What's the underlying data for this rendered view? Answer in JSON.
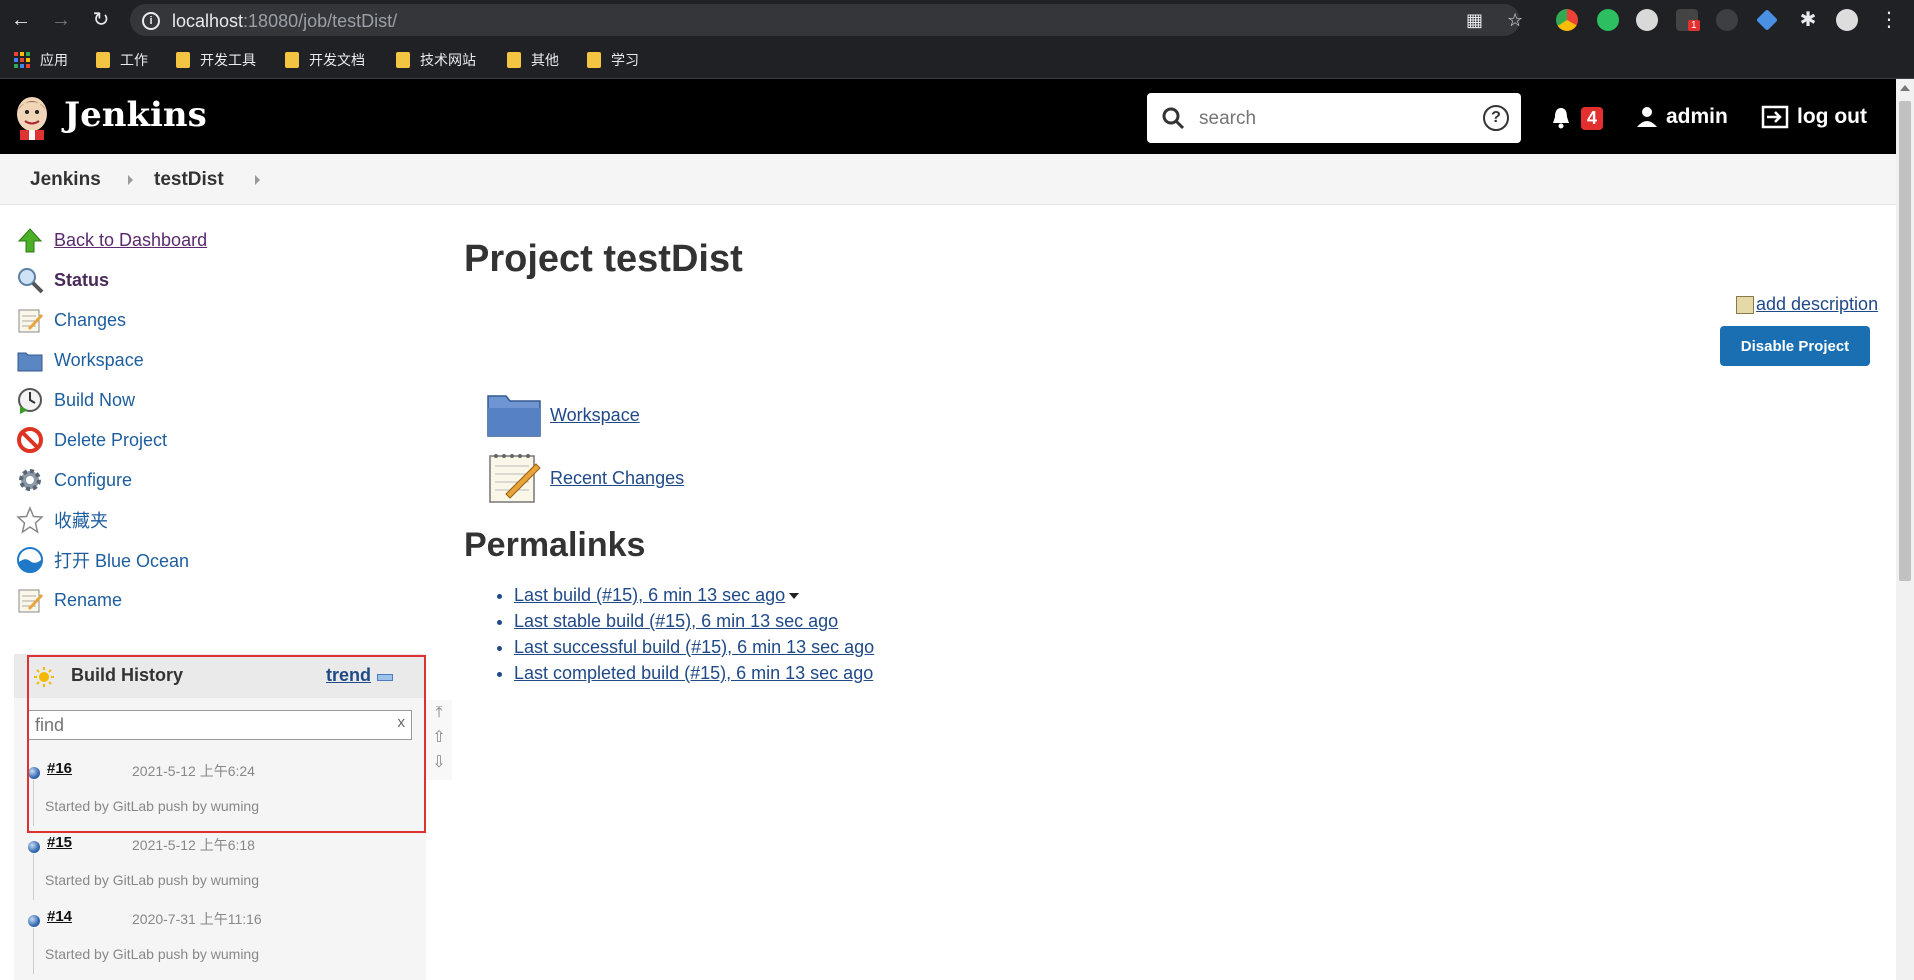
{
  "browser": {
    "url_host": "localhost",
    "url_path": ":18080/job/testDist/",
    "bookmarks": [
      {
        "label": "应用",
        "type": "apps"
      },
      {
        "label": "工作",
        "type": "folder"
      },
      {
        "label": "开发工具",
        "type": "folder"
      },
      {
        "label": "开发文档",
        "type": "folder"
      },
      {
        "label": "技术网站",
        "type": "folder"
      },
      {
        "label": "其他",
        "type": "folder"
      },
      {
        "label": "学习",
        "type": "folder"
      }
    ],
    "extension_badge": "1"
  },
  "header": {
    "brand": "Jenkins",
    "search_placeholder": "search",
    "notifications": "4",
    "user": "admin",
    "logout": "log out"
  },
  "breadcrumb": [
    "Jenkins",
    "testDist"
  ],
  "sidebar": {
    "tasks": [
      {
        "label": "Back to Dashboard",
        "icon": "up-arrow-icon"
      },
      {
        "label": "Status",
        "icon": "magnifier-icon"
      },
      {
        "label": "Changes",
        "icon": "notepad-icon"
      },
      {
        "label": "Workspace",
        "icon": "folder-icon"
      },
      {
        "label": "Build Now",
        "icon": "clock-play-icon"
      },
      {
        "label": "Delete Project",
        "icon": "no-entry-icon"
      },
      {
        "label": "Configure",
        "icon": "gear-icon"
      },
      {
        "label": "收藏夹",
        "icon": "star-icon"
      },
      {
        "label": "打开 Blue Ocean",
        "icon": "blue-ocean-icon"
      },
      {
        "label": "Rename",
        "icon": "notepad-icon"
      }
    ]
  },
  "build_history": {
    "title": "Build History",
    "trend": "trend",
    "find_placeholder": "find",
    "clear": "x",
    "builds": [
      {
        "number": "#16",
        "date": "2021-5-12 上午6:24",
        "cause": "Started by GitLab push by wuming"
      },
      {
        "number": "#15",
        "date": "2021-5-12 上午6:18",
        "cause": "Started by GitLab push by wuming"
      },
      {
        "number": "#14",
        "date": "2020-7-31 上午11:16",
        "cause": "Started by GitLab push by wuming"
      }
    ]
  },
  "main": {
    "title": "Project testDist",
    "add_description": "add description",
    "disable_button": "Disable Project",
    "links": [
      {
        "label": "Workspace",
        "icon": "folder-icon"
      },
      {
        "label": "Recent Changes",
        "icon": "notepad-icon"
      }
    ],
    "permalinks_title": "Permalinks",
    "permalinks": [
      "Last build (#15), 6 min 13 sec ago",
      "Last stable build (#15), 6 min 13 sec ago",
      "Last successful build (#15), 6 min 13 sec ago",
      "Last completed build (#15), 6 min 13 sec ago"
    ]
  },
  "colors": {
    "header_bg": "#000000",
    "link": "#204a87",
    "primary_button": "#1a6fb3",
    "notification_badge": "#e3302f",
    "highlight_box": "#e03131"
  }
}
